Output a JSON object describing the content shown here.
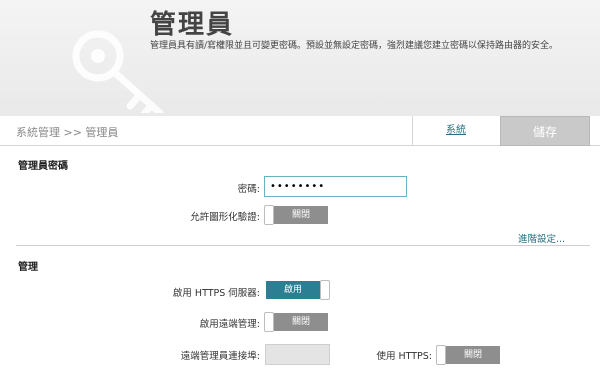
{
  "header": {
    "title": "管理員",
    "description": "管理員具有讀/寫權限並且可變更密碼。預設並無設定密碼，強烈建議您建立密碼以保持路由器的安全。"
  },
  "breadcrumb": "系統管理 >> 管理員",
  "toolbar": {
    "system_link": "系統",
    "save_label": "儲存"
  },
  "admin_password_section": {
    "title": "管理員密碼",
    "password_label": "密碼:",
    "password_value": "••••••••",
    "captcha_label": "允許圖形化驗證:",
    "captcha_toggle": "關閉",
    "advanced_link": "進階設定..."
  },
  "management_section": {
    "title": "管理",
    "https_server_label": "啟用 HTTPS 伺服器:",
    "https_server_toggle": "啟用",
    "remote_mgmt_label": "啟用遠端管理:",
    "remote_mgmt_toggle": "關閉",
    "remote_port_label": "遠端管理員連接埠:",
    "remote_port_value": "",
    "use_https_label": "使用 HTTPS:",
    "use_https_toggle": "關閉"
  },
  "colors": {
    "accent": "#2c7f93",
    "link": "#2a6f82",
    "toggle_off": "#8e8e8e"
  },
  "icons": {
    "hero": "key-icon"
  }
}
